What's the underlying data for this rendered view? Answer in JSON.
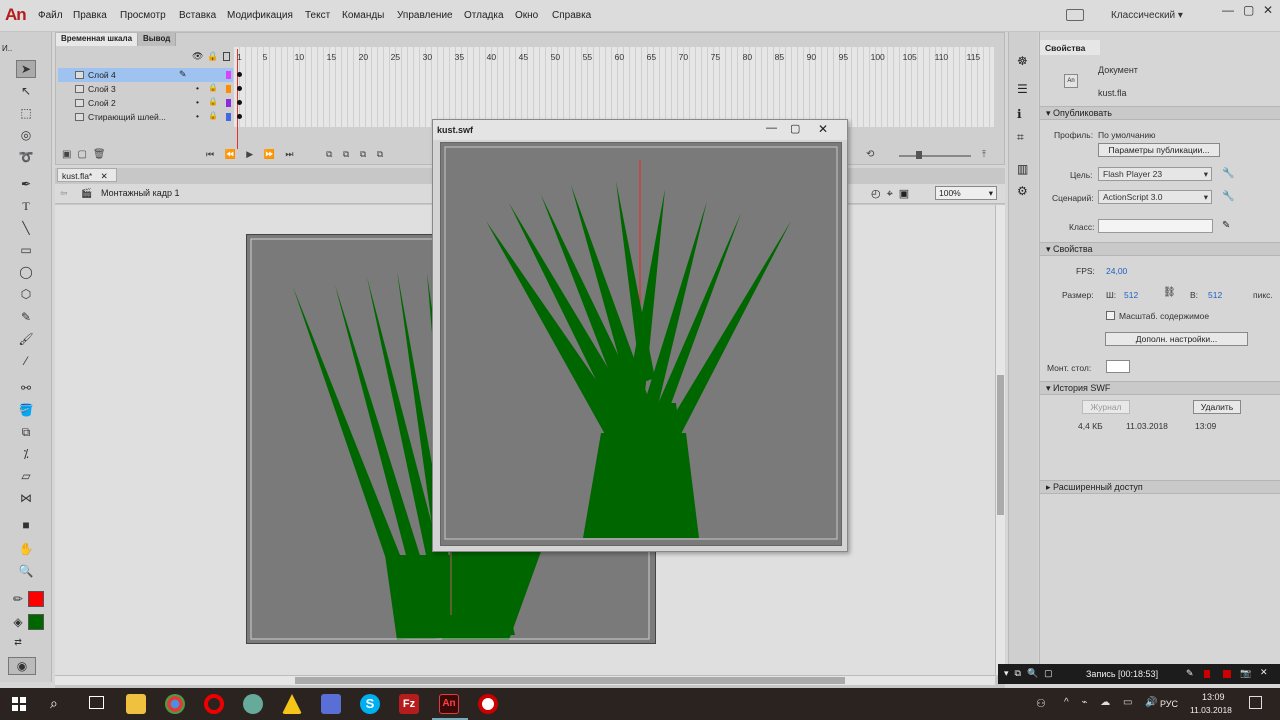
{
  "app": {
    "logo": "An"
  },
  "menu": [
    "Файл",
    "Правка",
    "Просмотр",
    "Вставка",
    "Модификация",
    "Текст",
    "Команды",
    "Управление",
    "Отладка",
    "Окно",
    "Справка"
  ],
  "workspace": {
    "label": "Классический ▾"
  },
  "window_controls": [
    "—",
    "▢",
    "✕"
  ],
  "timeline": {
    "tabs": [
      "Временная шкала",
      "Вывод"
    ],
    "frame_numbers": [
      "1",
      "5",
      "10",
      "15",
      "20",
      "25",
      "30",
      "35",
      "40",
      "45",
      "50",
      "55",
      "60",
      "65",
      "70",
      "75",
      "80",
      "85",
      "90",
      "95",
      "100",
      "105",
      "110",
      "115"
    ],
    "layers": [
      {
        "name": "Слой 4",
        "selected": true,
        "color": "#e040fb"
      },
      {
        "name": "Слой 3",
        "selected": false,
        "color": "#ff8c00"
      },
      {
        "name": "Слой 2",
        "selected": false,
        "color": "#8a2be2"
      },
      {
        "name": "Стирающий шлей...",
        "selected": false,
        "color": "#4169e1"
      }
    ]
  },
  "document": {
    "tab": "kust.fla*",
    "scene": "Монтажный кадр 1",
    "zoom": "100%"
  },
  "swf_window": {
    "title": "kust.swf"
  },
  "properties": {
    "panel_tabs": [
      "Свойства"
    ],
    "doc_type": "Документ",
    "doc_name": "kust.fla",
    "publish_section": "Опубликовать",
    "profile_label": "Профиль:",
    "profile_value": "По умолчанию",
    "publish_settings_btn": "Параметры публикации...",
    "target_label": "Цель:",
    "target_value": "Flash Player 23",
    "script_label": "Сценарий:",
    "script_value": "ActionScript 3.0",
    "class_label": "Класс:",
    "props_section": "Свойства",
    "fps_label": "FPS:",
    "fps_value": "24,00",
    "size_label": "Размер:",
    "width_label": "Ш:",
    "width_value": "512",
    "height_label": "В:",
    "height_value": "512",
    "units": "пикс.",
    "scale_label": "Масштаб. содержимое",
    "advanced_btn": "Дополн. настройки...",
    "stage_label": "Монт. стол:",
    "history_section": "История SWF",
    "log_btn": "Журнал",
    "delete_btn": "Удалить",
    "history_size": "4,4 КБ",
    "history_date": "11.03.2018",
    "history_time": "13:09",
    "sharing_section": "Расширенный доступ"
  },
  "recording": {
    "label": "Запись [00:18:53]"
  },
  "taskbar": {
    "lang": "РУС",
    "time": "13:09",
    "date": "11.03.2018"
  },
  "colors": {
    "stroke": "#ff0000",
    "fill": "#006600",
    "stage": "#7a7a7a"
  }
}
